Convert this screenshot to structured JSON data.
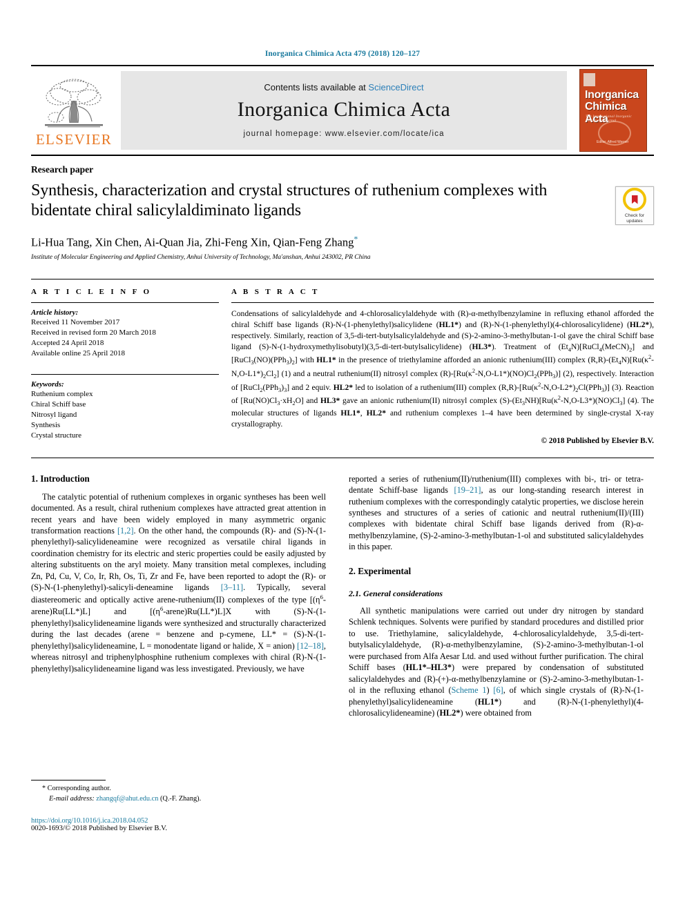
{
  "running_head": "Inorganica Chimica Acta 479 (2018) 120–127",
  "masthead": {
    "elsevier_word": "ELSEVIER",
    "contents_prefix": "Contents lists available at ",
    "contents_link": "ScienceDirect",
    "journal_title": "Inorganica Chimica Acta",
    "homepage": "journal homepage: www.elsevier.com/locate/ica",
    "cover": {
      "line1": "Inorganica",
      "line2": "Chimica Acta",
      "subtitle": "The International Inorganic Chemistry Journal",
      "footer": "Editor: Alfred Werner"
    }
  },
  "article": {
    "type": "Research paper",
    "title": "Synthesis, characterization and crystal structures of ruthenium complexes with bidentate chiral salicylaldiminato ligands",
    "authors": "Li-Hua Tang, Xin Chen, Ai-Quan Jia, Zhi-Feng Xin, Qian-Feng Zhang",
    "author_marker": "*",
    "affiliation": "Institute of Molecular Engineering and Applied Chemistry, Anhui University of Technology, Ma'anshan, Anhui 243002, PR China",
    "crossmark_label_line1": "Check for",
    "crossmark_label_line2": "updates"
  },
  "info": {
    "heading": "A R T I C L E   I N F O",
    "history_label": "Article history:",
    "history": [
      "Received 11 November 2017",
      "Received in revised form 20 March 2018",
      "Accepted 24 April 2018",
      "Available online 25 April 2018"
    ],
    "keywords_label": "Keywords:",
    "keywords": [
      "Ruthenium complex",
      "Chiral Schiff base",
      "Nitrosyl ligand",
      "Synthesis",
      "Crystal structure"
    ]
  },
  "abstract": {
    "heading": "A B S T R A C T",
    "text": "Condensations of salicylaldehyde and 4-chlorosalicylaldehyde with (R)-α-methylbenzylamine in refluxing ethanol afforded the chiral Schiff base ligands (R)-N-(1-phenylethyl)salicylidene (HL1*) and (R)-N-(1-phenylethyl)(4-chlorosalicylidene) (HL2*), respectively. Similarly, reaction of 3,5-di-tert-butylsalicylaldehyde and (S)-2-amino-3-methylbutan-1-ol gave the chiral Schiff base ligand (S)-N-(1-hydroxymethylisobutyl)(3,5-di-tert-butylsalicylidene) (HL3*). Treatment of (Et4N)[RuCl4(MeCN)2] and [RuCl3(NO)(PPh3)2] with HL1* in the presence of triethylamine afforded an anionic ruthenium(III) complex (R,R)-(Et4N)[Ru(κ2-N,O-L1*)2Cl2] (1) and a neutral ruthenium(II) nitrosyl complex (R)-[Ru(κ2-N,O-L1*)(NO)Cl2(PPh3)] (2), respectively. Interaction of [RuCl2(PPh3)3] and 2 equiv. HL2* led to isolation of a ruthenium(III) complex (R,R)-[Ru(κ2-N,O-L2*)2Cl(PPh3)] (3). Reaction of [Ru(NO)Cl3·xH2O] and HL3* gave an anionic ruthenium(II) nitrosyl complex (S)-(Et3NH)[Ru(κ2-N,O-L3*)(NO)Cl3] (4). The molecular structures of ligands HL1*, HL2* and ruthenium complexes 1–4 have been determined by single-crystal X-ray crystallography.",
    "copyright": "© 2018 Published by Elsevier B.V."
  },
  "body": {
    "intro_heading": "1. Introduction",
    "intro_p1": "The catalytic potential of ruthenium complexes in organic syntheses has been well documented. As a result, chiral ruthenium complexes have attracted great attention in recent years and have been widely employed in many asymmetric organic transformation reactions [1,2]. On the other hand, the compounds (R)- and (S)-N-(1-phenylethyl)-salicylideneamine were recognized as versatile chiral ligands in coordination chemistry for its electric and steric properties could be easily adjusted by altering substituents on the aryl moiety. Many transition metal complexes, including Zn, Pd, Cu, V, Co, Ir, Rh, Os, Ti, Zr and Fe, have been reported to adopt the (R)- or (S)-N-(1-phenylethyl)-salicyli-deneamine ligands [3–11]. Typically, several diastereomeric and optically active arene-ruthenium(II) complexes of the type [(η6-arene)Ru(LL*)L] and [(η6-arene)Ru(LL*)L]X with (S)-N-(1-phenylethyl)salicylideneamine ligands were synthesized and structurally characterized during the last decades (arene = benzene and p-cymene, LL* = (S)-N-(1-phenylethyl)salicylideneamine, L = monodentate ligand or halide, X = anion) [12–18], whereas nitrosyl and triphenylphosphine ruthenium complexes with chiral (R)-N-(1-phenylethyl)salicylideneamine ligand was less investigated. Previously, we have",
    "intro_p2": "reported a series of ruthenium(II)/ruthenium(III) complexes with bi-, tri- or tetra-dentate Schiff-base ligands [19–21], as our long-standing research interest in ruthenium complexes with the correspondingly catalytic properties, we disclose herein syntheses and structures of a series of cationic and neutral ruthenium(II)/(III) complexes with bidentate chiral Schiff base ligands derived from (R)-α-methylbenzylamine, (S)-2-amino-3-methylbutan-1-ol and substituted salicylaldehydes in this paper.",
    "exp_heading": "2. Experimental",
    "exp_subheading": "2.1. General considerations",
    "exp_p1": "All synthetic manipulations were carried out under dry nitrogen by standard Schlenk techniques. Solvents were purified by standard procedures and distilled prior to use. Triethylamine, salicylaldehyde, 4-chlorosalicylaldehyde, 3,5-di-tert-butylsalicylaldehyde, (R)-α-methylbenzylamine, (S)-2-amino-3-methylbutan-1-ol were purchased from Alfa Aesar Ltd. and used without further purification. The chiral Schiff bases (HL1*–HL3*) were prepared by condensation of substituted salicylaldehydes and (R)-(+)-α-methylbenzylamine or (S)-2-amino-3-methylbutan-1-ol in the refluxing ethanol (Scheme 1) [6], of which single crystals of (R)-N-(1-phenylethyl)salicylideneamine (HL1*) and (R)-N-(1-phenylethyl)(4-chlorosalicylideneamine) (HL2*) were obtained from"
  },
  "footer": {
    "corresponding_marker": "*",
    "corresponding_label": "Corresponding author.",
    "email_label": "E-mail address:",
    "email": "zhangqf@ahut.edu.cn",
    "email_suffix": "(Q.-F. Zhang).",
    "doi": "https://doi.org/10.1016/j.ica.2018.04.052",
    "issn_line": "0020-1693/© 2018 Published by Elsevier B.V."
  },
  "colors": {
    "link": "#1a7a9e",
    "elsevier_orange": "#e87722",
    "cover_orange": "#c9461d",
    "masthead_gray": "#e6e6e6"
  }
}
